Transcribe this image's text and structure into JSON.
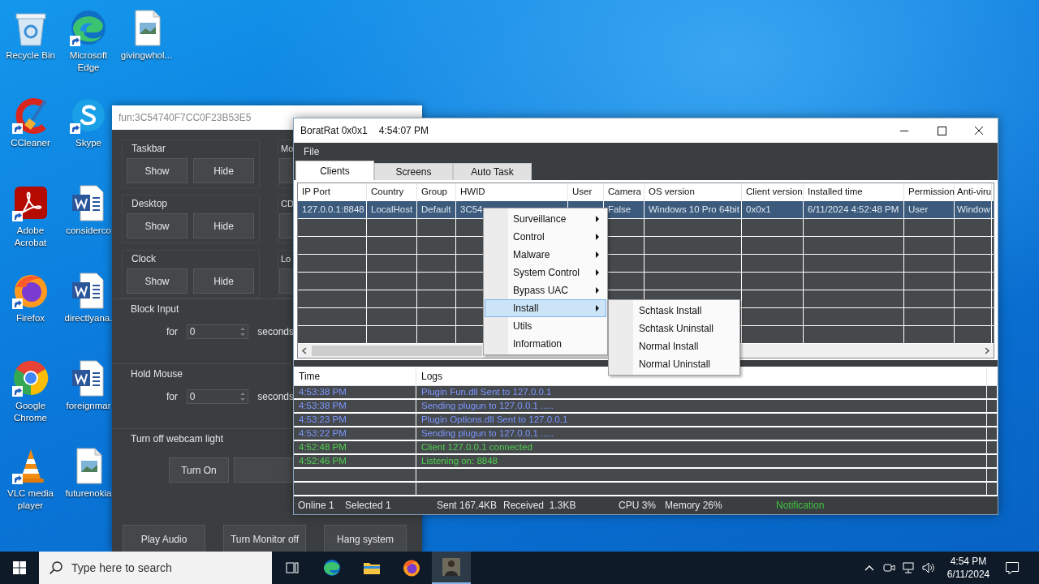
{
  "desktop": {
    "icons": [
      {
        "label": "Recycle Bin",
        "kind": "recycle",
        "shortcut": false
      },
      {
        "label": "CCleaner",
        "kind": "ccleaner",
        "shortcut": true
      },
      {
        "label": "Adobe Acrobat",
        "kind": "acrobat",
        "shortcut": true
      },
      {
        "label": "Firefox",
        "kind": "firefox",
        "shortcut": true
      },
      {
        "label": "Google Chrome",
        "kind": "chrome",
        "shortcut": true
      },
      {
        "label": "VLC media player",
        "kind": "vlc",
        "shortcut": true
      },
      {
        "label": "Microsoft Edge",
        "kind": "edge",
        "shortcut": true
      },
      {
        "label": "Skype",
        "kind": "skype",
        "shortcut": true
      },
      {
        "label": "considerco",
        "kind": "word",
        "shortcut": false
      },
      {
        "label": "directlyana.",
        "kind": "word",
        "shortcut": false
      },
      {
        "label": "foreignmar",
        "kind": "word",
        "shortcut": false
      },
      {
        "label": "futurenokia",
        "kind": "image",
        "shortcut": false
      },
      {
        "label": "givingwhol...",
        "kind": "image",
        "shortcut": false
      }
    ]
  },
  "fun_window": {
    "title": "fun:3C54740F7CC0F23B53E5",
    "toggle_groups": [
      {
        "title": "Taskbar",
        "buttons": [
          "Show",
          "Hide"
        ]
      },
      {
        "title": "Desktop",
        "buttons": [
          "Show",
          "Hide"
        ]
      },
      {
        "title": "Clock",
        "buttons": [
          "Show",
          "Hide"
        ]
      }
    ],
    "side_groups": [
      {
        "title": "Mo"
      },
      {
        "title": "CD"
      },
      {
        "title": "Lo"
      }
    ],
    "timer_groups": [
      {
        "title": "Block Input",
        "for_label": "for",
        "value": "0",
        "unit": "seconds"
      },
      {
        "title": "Hold Mouse",
        "for_label": "for",
        "value": "0",
        "unit": "seconds"
      }
    ],
    "webcam_group": {
      "title": "Turn off webcam light",
      "button": "Turn On"
    },
    "bottom_buttons": [
      "Play Audio",
      "Turn Monitor off",
      "Hang system"
    ]
  },
  "rat_window": {
    "title": "BoratRat 0x0x1",
    "clock": "4:54:07 PM",
    "menu": [
      "File"
    ],
    "tabs": [
      {
        "label": "Clients",
        "selected": true
      },
      {
        "label": "Screens",
        "selected": false
      },
      {
        "label": "Auto Task",
        "selected": false
      }
    ],
    "clients": {
      "columns": [
        "IP Port",
        "Country",
        "Group",
        "HWID",
        "User",
        "Camera",
        "OS version",
        "Client version",
        "Installed time",
        "Permission",
        "Anti-viru"
      ],
      "rows": [
        {
          "selected": true,
          "cells": [
            "127.0.0.1:8848",
            "LocalHost",
            "Default",
            "3C54",
            null,
            "False",
            "Windows 10 Pro 64bit",
            "0x0x1",
            "6/11/2024 4:52:48 PM",
            "User",
            "Window"
          ]
        }
      ]
    },
    "logs": {
      "columns": [
        "Time",
        "Logs"
      ],
      "rows": [
        {
          "time": "4:53:38 PM",
          "message": "Plugin Fun.dll Sent to 127.0.0.1",
          "kind": "info"
        },
        {
          "time": "4:53:38 PM",
          "message": "Sending plugun to 127.0.0.1 .....",
          "kind": "info"
        },
        {
          "time": "4:53:23 PM",
          "message": "Plugin Options.dll Sent to 127.0.0.1",
          "kind": "info"
        },
        {
          "time": "4:53:22 PM",
          "message": "Sending plugun to 127.0.0.1 .....",
          "kind": "info"
        },
        {
          "time": "4:52:48 PM",
          "message": "Client 127.0.0.1 connected",
          "kind": "success"
        },
        {
          "time": "4:52:46 PM",
          "message": "Listening on: 8848",
          "kind": "success"
        }
      ]
    },
    "status": [
      "Online 1",
      "Selected 1",
      "Sent 167.4KB",
      "Received  1.3KB",
      "CPU 3%",
      "Memory 26%"
    ],
    "notification": "Notification",
    "context_menu": {
      "items": [
        {
          "label": "Surveillance",
          "submenu": true,
          "selected": false
        },
        {
          "label": "Control",
          "submenu": true,
          "selected": false
        },
        {
          "label": "Malware",
          "submenu": true,
          "selected": false
        },
        {
          "label": "System Control",
          "submenu": true,
          "selected": false
        },
        {
          "label": "Bypass UAC",
          "submenu": true,
          "selected": false
        },
        {
          "label": "Install",
          "submenu": true,
          "selected": true
        },
        {
          "label": "Utils",
          "submenu": false,
          "selected": false
        },
        {
          "label": "Information",
          "submenu": false,
          "selected": false
        }
      ],
      "submenu": [
        "Schtask Install",
        "Schtask Uninstall",
        "Normal Install",
        "Normal Uninstall"
      ]
    }
  },
  "taskbar": {
    "search": {
      "placeholder": "Type here to search"
    },
    "apps": [
      {
        "kind": "taskview",
        "active": false
      },
      {
        "kind": "edge",
        "active": false
      },
      {
        "kind": "explorer",
        "active": false
      },
      {
        "kind": "firefox",
        "active": false
      },
      {
        "kind": "person",
        "active": true
      }
    ],
    "clock": {
      "time": "4:54 PM",
      "date": "6/11/2024"
    }
  }
}
